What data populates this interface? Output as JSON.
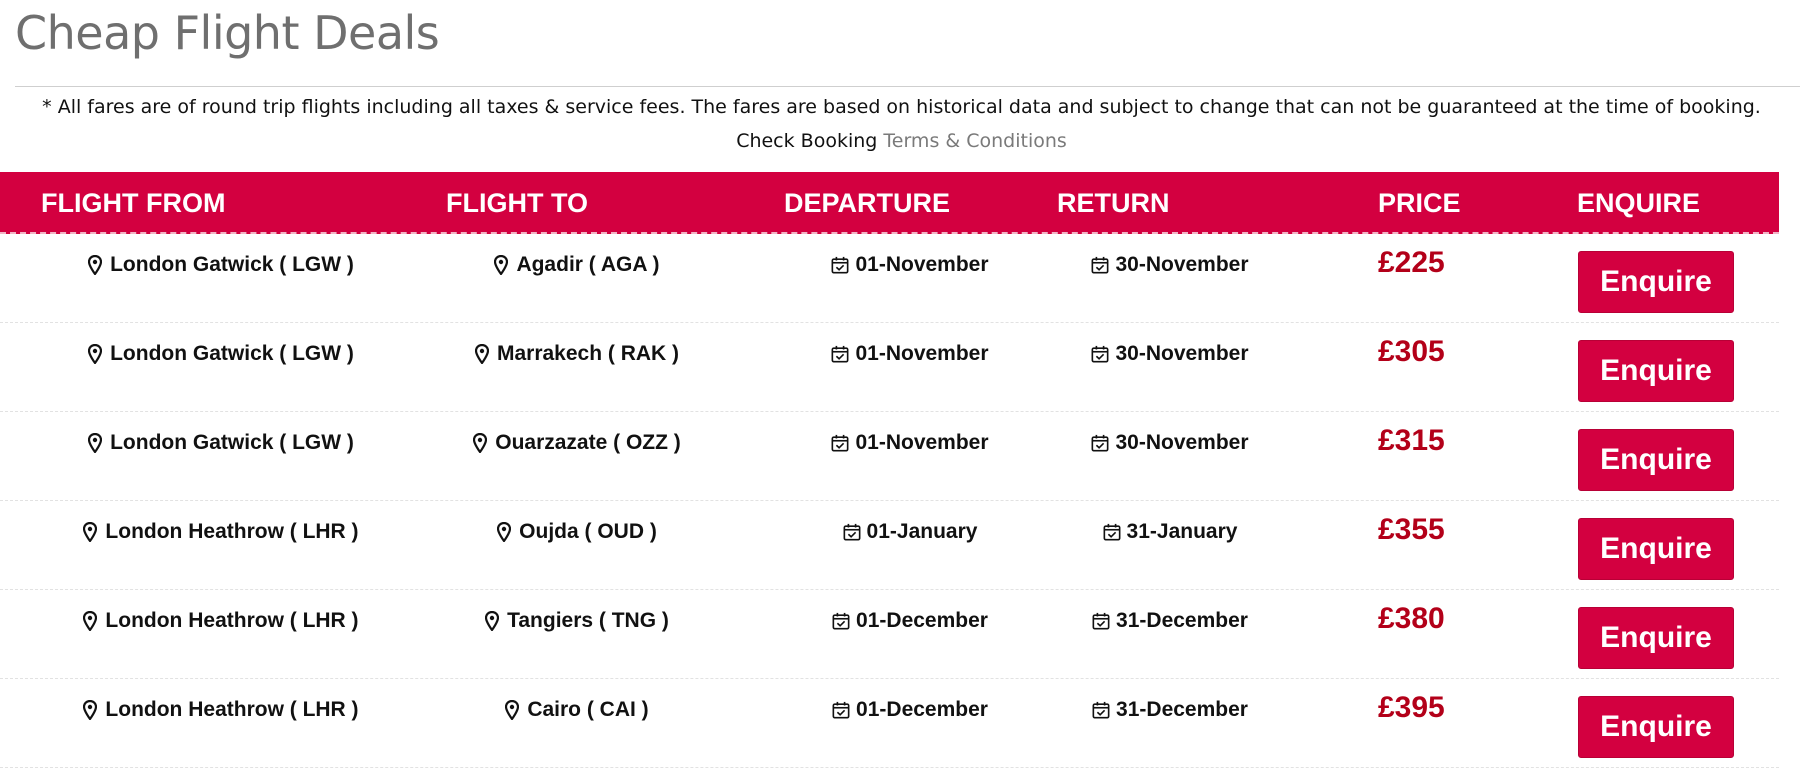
{
  "page": {
    "title": "Cheap Flight Deals",
    "disclaimer": "* All fares are of round trip flights including all taxes & service fees. The fares are based on historical data and subject to change that can not be guaranteed at the time of booking.",
    "check_booking_label": "Check Booking",
    "terms_link": "Terms & Conditions"
  },
  "table": {
    "headers": {
      "from": "FLIGHT FROM",
      "to": "FLIGHT TO",
      "departure": "DEPARTURE",
      "return": "RETURN",
      "price": "PRICE",
      "enquire": "ENQUIRE"
    },
    "rows": [
      {
        "from": "London Gatwick ( LGW )",
        "to": "Agadir ( AGA )",
        "departure": "01-November",
        "return": "30-November",
        "price": "£225",
        "button": "Enquire"
      },
      {
        "from": "London Gatwick ( LGW )",
        "to": "Marrakech ( RAK )",
        "departure": "01-November",
        "return": "30-November",
        "price": "£305",
        "button": "Enquire"
      },
      {
        "from": "London Gatwick ( LGW )",
        "to": "Ouarzazate ( OZZ )",
        "departure": "01-November",
        "return": "30-November",
        "price": "£315",
        "button": "Enquire"
      },
      {
        "from": "London Heathrow ( LHR )",
        "to": "Oujda ( OUD )",
        "departure": "01-January",
        "return": "31-January",
        "price": "£355",
        "button": "Enquire"
      },
      {
        "from": "London Heathrow ( LHR )",
        "to": "Tangiers ( TNG )",
        "departure": "01-December",
        "return": "31-December",
        "price": "£380",
        "button": "Enquire"
      },
      {
        "from": "London Heathrow ( LHR )",
        "to": "Cairo ( CAI )",
        "departure": "01-December",
        "return": "31-December",
        "price": "£395",
        "button": "Enquire"
      }
    ]
  },
  "icons": {
    "location": "map-marker-icon",
    "calendar": "calendar-check-icon"
  },
  "colors": {
    "accent": "#d30040",
    "price": "#b30019",
    "title": "#6f6f6f"
  }
}
